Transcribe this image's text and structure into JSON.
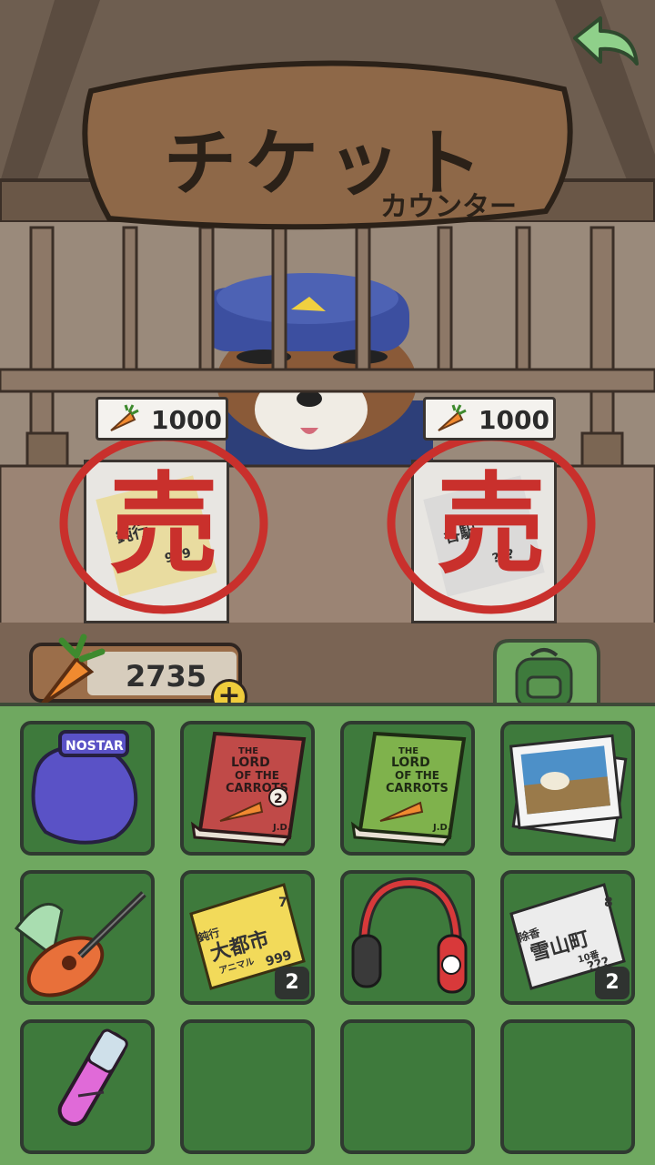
{
  "sign": {
    "title": "チケット",
    "subtitle": "カウンター"
  },
  "counter": {
    "tickets": [
      {
        "price": "1000",
        "stamp": "売",
        "sold": true,
        "ticket_text": "鈍行",
        "ticket_text2": "999"
      },
      {
        "price": "1000",
        "stamp": "売",
        "sold": true,
        "ticket_text": "各駅",
        "ticket_text2": "???"
      }
    ]
  },
  "wallet": {
    "carrots": "2735",
    "add_label": "+"
  },
  "inventory": {
    "items": [
      {
        "name": "boxing-gloves",
        "text": "NOSTAR"
      },
      {
        "name": "book-red",
        "title_line1": "THE",
        "title_line2": "LORD",
        "title_line3": "OF THE",
        "title_line4": "CARROTS",
        "volume": "2",
        "author": "J.D."
      },
      {
        "name": "book-green",
        "title_line1": "THE",
        "title_line2": "LORD",
        "title_line3": "OF THE",
        "title_line4": "CARROTS",
        "author": "J.D."
      },
      {
        "name": "photos"
      },
      {
        "name": "ukulele"
      },
      {
        "name": "ticket-gold",
        "line1": "鈍行",
        "line2": "大都市",
        "line3": "アニマル",
        "line4": "999",
        "number": "7",
        "count": "2"
      },
      {
        "name": "headphones"
      },
      {
        "name": "ticket-white",
        "line1": "除香",
        "line2": "雪山町",
        "line3": "10番",
        "line4": "???",
        "number": "8",
        "count": "2"
      },
      {
        "name": "potion"
      },
      {
        "name": "empty"
      },
      {
        "name": "empty"
      },
      {
        "name": "empty"
      }
    ]
  },
  "colors": {
    "wood": "#7b6653",
    "inventory_bg": "#6fa860",
    "slot_bg": "#3e7a3c",
    "stamp_red": "#c9302c"
  }
}
